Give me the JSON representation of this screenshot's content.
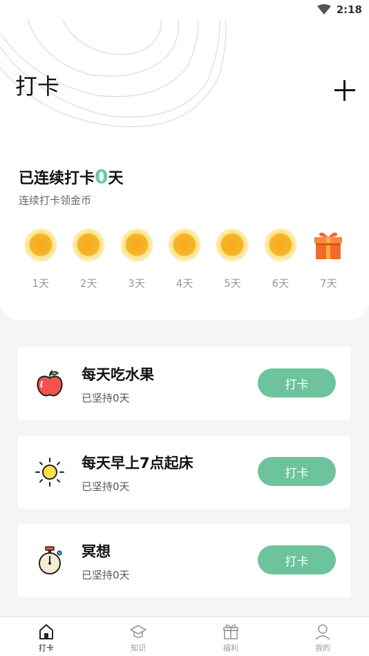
{
  "status_bar": {
    "time": "2:18",
    "wifi_icon": "wifi-icon"
  },
  "header": {
    "title": "打卡",
    "add_icon": "plus-icon"
  },
  "streak": {
    "title_prefix": "已连续打卡",
    "count": "0",
    "title_suffix": "天",
    "subtitle": "连续打卡领金币",
    "days": [
      {
        "label": "1天",
        "reward": "coin"
      },
      {
        "label": "2天",
        "reward": "coin"
      },
      {
        "label": "3天",
        "reward": "coin"
      },
      {
        "label": "4天",
        "reward": "coin"
      },
      {
        "label": "5天",
        "reward": "coin"
      },
      {
        "label": "6天",
        "reward": "coin"
      },
      {
        "label": "7天",
        "reward": "gift"
      }
    ]
  },
  "habits": [
    {
      "name": "每天吃水果",
      "kept": "已坚持0天",
      "button": "打卡",
      "icon": "apple-icon"
    },
    {
      "name": "每天早上7点起床",
      "kept": "已坚持0天",
      "button": "打卡",
      "icon": "sun-icon"
    },
    {
      "name": "冥想",
      "kept": "已坚持0天",
      "button": "打卡",
      "icon": "stopwatch-icon"
    }
  ],
  "nav": {
    "items": [
      {
        "label": "打卡",
        "icon": "home-icon",
        "active": true
      },
      {
        "label": "知识",
        "icon": "graduation-cap-icon",
        "active": false
      },
      {
        "label": "福利",
        "icon": "gift-box-icon",
        "active": false
      },
      {
        "label": "我的",
        "icon": "user-icon",
        "active": false
      }
    ]
  },
  "colors": {
    "accent": "#6cc39c",
    "streak_count": "#6cc8a4",
    "coin": "#f7b52a",
    "background": "#f5f5f5"
  }
}
